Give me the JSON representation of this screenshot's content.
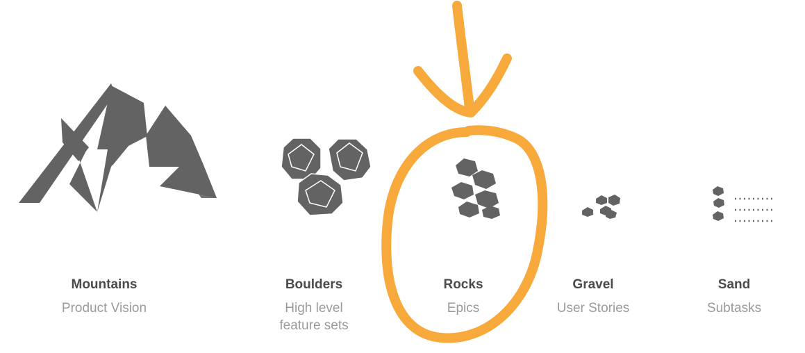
{
  "items": [
    {
      "title": "Mountains",
      "subtitle": "Product Vision",
      "icon": "mountains-icon"
    },
    {
      "title": "Boulders",
      "subtitle": "High level\nfeature sets",
      "icon": "boulders-icon"
    },
    {
      "title": "Rocks",
      "subtitle": "Epics",
      "icon": "rocks-icon"
    },
    {
      "title": "Gravel",
      "subtitle": "User Stories",
      "icon": "gravel-icon"
    },
    {
      "title": "Sand",
      "subtitle": "Subtasks",
      "icon": "sand-icon"
    }
  ],
  "colors": {
    "icon": "#636363",
    "title": "#4b4b4b",
    "subtitle": "#9a9a9a",
    "highlight": "#f8a93c"
  }
}
